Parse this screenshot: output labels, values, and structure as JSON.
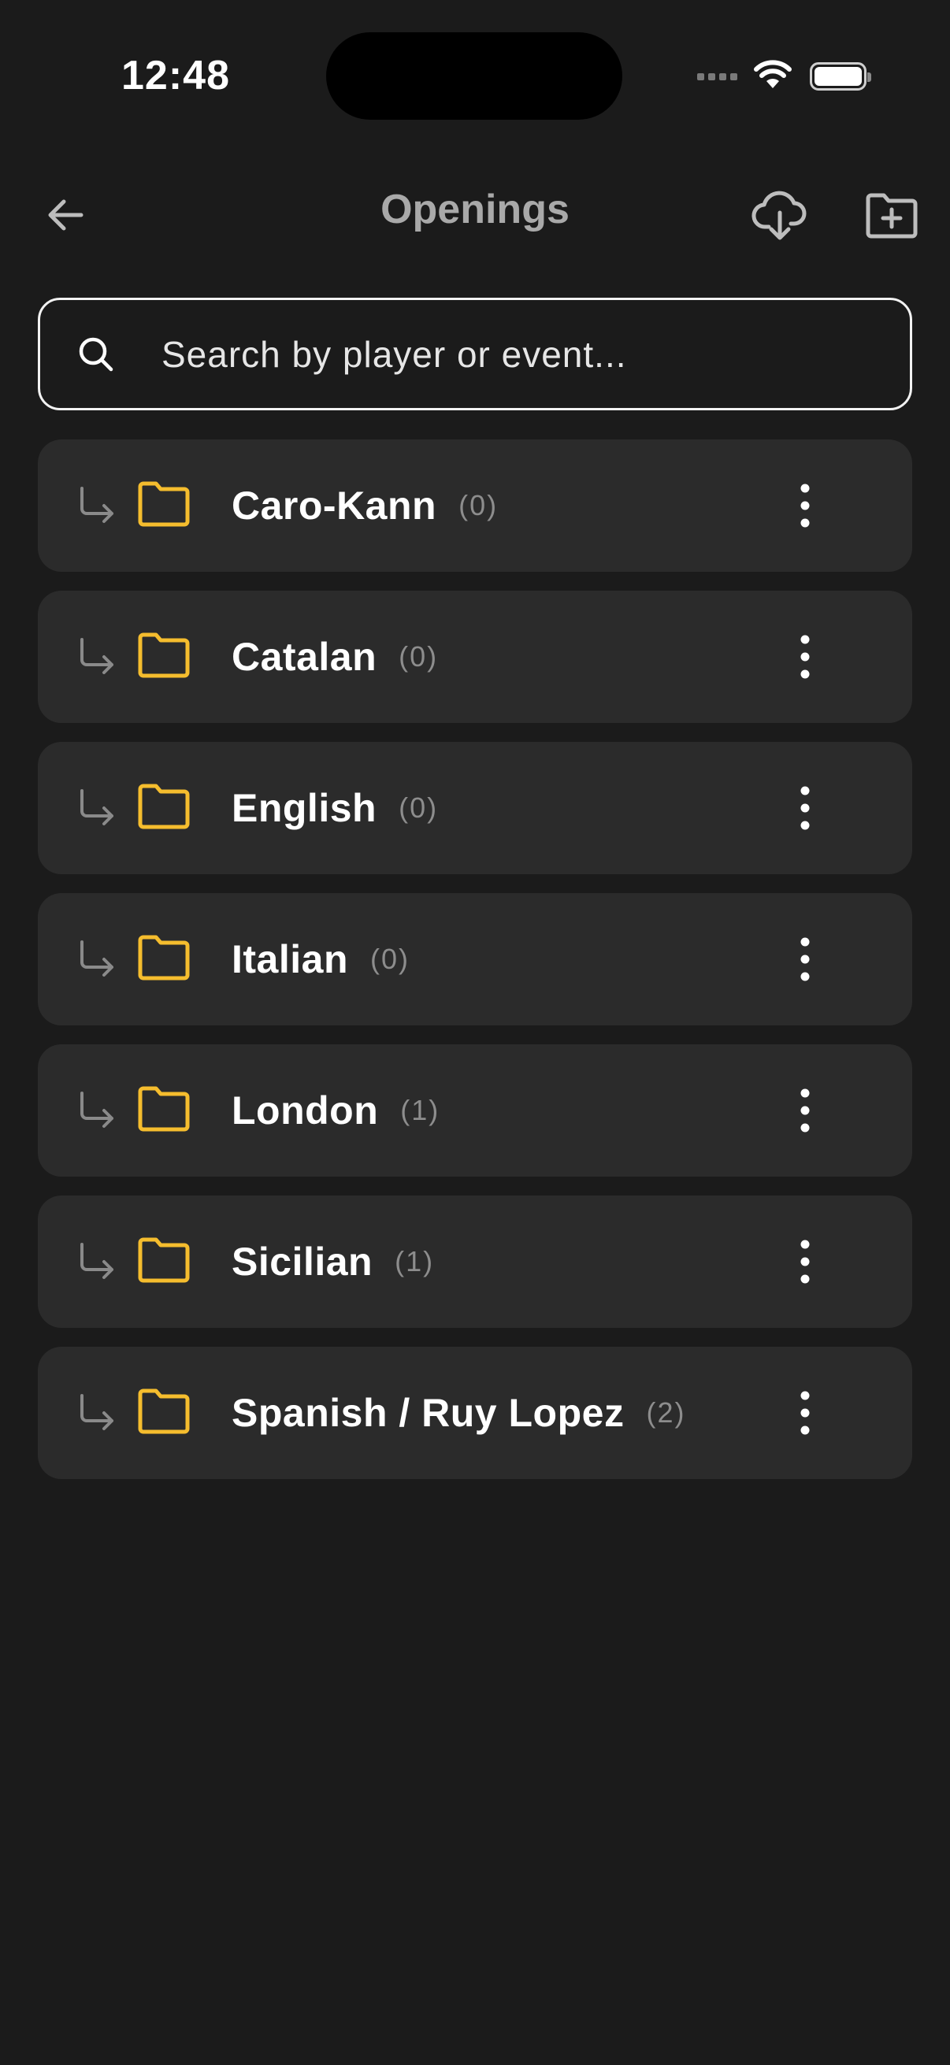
{
  "status_bar": {
    "time": "12:48"
  },
  "header": {
    "title": "Openings",
    "back_icon": "arrow-left-icon",
    "download_icon": "cloud-download-icon",
    "new_folder_icon": "folder-plus-icon"
  },
  "search": {
    "placeholder": "Search by player or event...",
    "value": ""
  },
  "folders": [
    {
      "name": "Caro-Kann",
      "count": "(0)"
    },
    {
      "name": "Catalan",
      "count": "(0)"
    },
    {
      "name": "English",
      "count": "(0)"
    },
    {
      "name": "Italian",
      "count": "(0)"
    },
    {
      "name": "London",
      "count": "(1)"
    },
    {
      "name": "Sicilian",
      "count": "(1)"
    },
    {
      "name": "Spanish / Ruy Lopez",
      "count": "(2)"
    }
  ],
  "colors": {
    "background": "#1b1b1b",
    "row_background": "#2b2b2b",
    "folder_accent": "#f5bd2e",
    "title_gray": "#a9a9a9",
    "count_gray": "#8d8d8d"
  }
}
